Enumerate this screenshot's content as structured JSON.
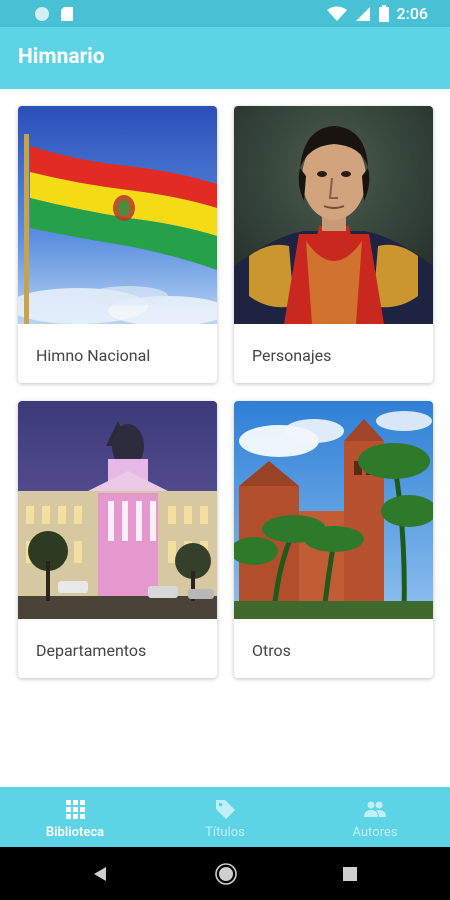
{
  "status_bar": {
    "time": "2:06",
    "icons": [
      "circle-icon",
      "sd-card-icon",
      "wifi-icon",
      "signal-icon",
      "battery-icon"
    ]
  },
  "app_bar": {
    "title": "Himnario"
  },
  "cards": [
    {
      "label": "Himno Nacional",
      "image": "bolivian-flag"
    },
    {
      "label": "Personajes",
      "image": "portrait-painting"
    },
    {
      "label": "Departamentos",
      "image": "government-palace"
    },
    {
      "label": "Otros",
      "image": "cathedral-palms"
    }
  ],
  "bottom_nav": {
    "items": [
      {
        "label": "Biblioteca",
        "icon": "grid-icon",
        "active": true
      },
      {
        "label": "Títulos",
        "icon": "tag-icon",
        "active": false
      },
      {
        "label": "Autores",
        "icon": "people-icon",
        "active": false
      }
    ]
  },
  "colors": {
    "status_bar": "#49C1D4",
    "app_bar": "#5DD3E6",
    "bottom_nav": "#5DD3E6",
    "nav_inactive": "#BFEFF7"
  }
}
